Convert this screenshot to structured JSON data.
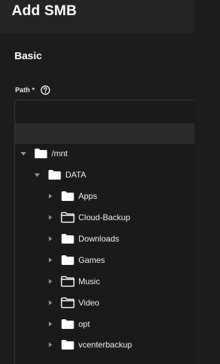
{
  "header": {
    "title": "Add SMB"
  },
  "section": {
    "title": "Basic"
  },
  "path_field": {
    "label": "Path *",
    "value": "",
    "help_icon": "help-circle-icon"
  },
  "tree": [
    {
      "label": "/mnt",
      "depth": 0,
      "expanded": true,
      "folder": "filled"
    },
    {
      "label": "DATA",
      "depth": 1,
      "expanded": true,
      "folder": "filled"
    },
    {
      "label": "Apps",
      "depth": 2,
      "expanded": false,
      "folder": "filled"
    },
    {
      "label": "Cloud-Backup",
      "depth": 2,
      "expanded": false,
      "folder": "outline"
    },
    {
      "label": "Downloads",
      "depth": 2,
      "expanded": false,
      "folder": "filled"
    },
    {
      "label": "Games",
      "depth": 2,
      "expanded": false,
      "folder": "filled"
    },
    {
      "label": "Music",
      "depth": 2,
      "expanded": false,
      "folder": "outline"
    },
    {
      "label": "Video",
      "depth": 2,
      "expanded": false,
      "folder": "outline"
    },
    {
      "label": "opt",
      "depth": 2,
      "expanded": false,
      "folder": "filled"
    },
    {
      "label": "vcenterbackup",
      "depth": 2,
      "expanded": false,
      "folder": "filled"
    }
  ]
}
